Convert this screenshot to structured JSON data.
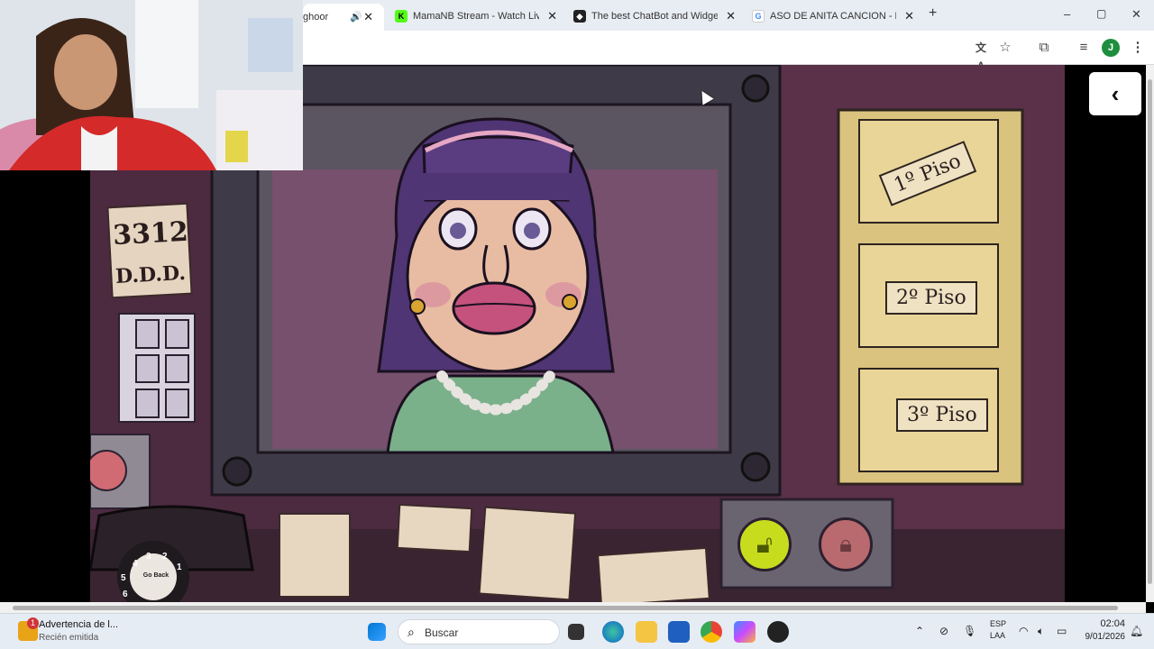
{
  "browser": {
    "tabs": [
      {
        "label": "ghoor",
        "active": true,
        "audio": true
      },
      {
        "label": "MamaNB Stream - Watch Live o",
        "favicon_color": "#53fc18",
        "favicon_text": "K"
      },
      {
        "label": "The best ChatBot and Widgets",
        "favicon_color": "#222222",
        "favicon_text": "◆"
      },
      {
        "label": "ASO DE ANITA CANCION - Bus",
        "favicon_color": "#4285f4",
        "favicon_text": "G"
      }
    ],
    "new_tab": "+",
    "window_controls": {
      "minimize": "–",
      "maximize": "▢",
      "close": "✕"
    },
    "profile_initial": "J"
  },
  "game": {
    "id_tag": {
      "line1": "3312",
      "line2": "D.D.D."
    },
    "floors": [
      {
        "label": "1º Piso"
      },
      {
        "label": "2º Piso"
      },
      {
        "label": "3º Piso"
      }
    ],
    "phone_dial": {
      "digits": [
        "4",
        "3",
        "2",
        "1",
        "5",
        "6"
      ],
      "center": "Go Back"
    },
    "lock_open": "unlocked-padlock",
    "lock_closed": "locked-padlock",
    "back_arrow": "‹"
  },
  "taskbar": {
    "notification": {
      "badge": "1",
      "title": "Advertencia de l...",
      "subtitle": "Recién emitida"
    },
    "search_placeholder": "Buscar",
    "lang": {
      "line1": "ESP",
      "line2": "LAA"
    },
    "clock": {
      "time": "02:04",
      "date": "9/01/2026"
    }
  },
  "colors": {
    "game_bg": "#4c2a40",
    "lock_green": "#c8dc1e",
    "lock_red": "#b86a6e",
    "folder": "#e9d598"
  }
}
